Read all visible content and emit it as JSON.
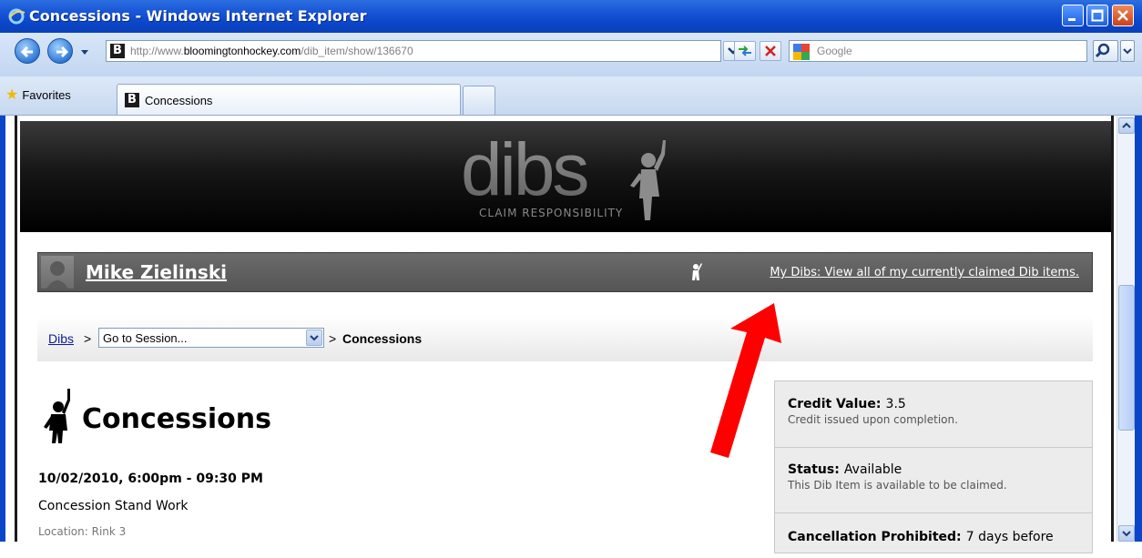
{
  "window": {
    "title": "Concessions - Windows Internet Explorer"
  },
  "address_bar": {
    "url_prefix": "http://www.",
    "url_domain": "bloomingtonhockey.com",
    "url_path": "/dib_item/show/136670"
  },
  "search": {
    "placeholder": "Google"
  },
  "favorites": {
    "label": "Favorites"
  },
  "tabs": [
    {
      "label": "Concessions"
    }
  ],
  "banner": {
    "logo_text": "dibs",
    "tagline": "CLAIM RESPONSIBILITY"
  },
  "user_bar": {
    "username": "Mike Zielinski",
    "my_dibs_link": "My Dibs: View all of my currently claimed Dib items."
  },
  "breadcrumb": {
    "root": "Dibs",
    "separator": ">",
    "session_select": "Go to Session...",
    "current": "Concessions"
  },
  "item": {
    "title": "Concessions",
    "datetime": "10/02/2010, 6:00pm - 09:30 PM",
    "description": "Concession Stand Work",
    "location": "Location: Rink 3"
  },
  "info": {
    "credit_label": "Credit Value:",
    "credit_value": "3.5",
    "credit_sub": "Credit issued upon completion.",
    "status_label": "Status:",
    "status_value": "Available",
    "status_sub": "This Dib Item is available to be claimed.",
    "cancel_label": "Cancellation Prohibited:",
    "cancel_value": "7 days before"
  },
  "colors": {
    "titlebar": "#0b46c9",
    "annotation_arrow": "#ff0000",
    "user_bar": "#5f5f5f",
    "banner": "#000000"
  }
}
